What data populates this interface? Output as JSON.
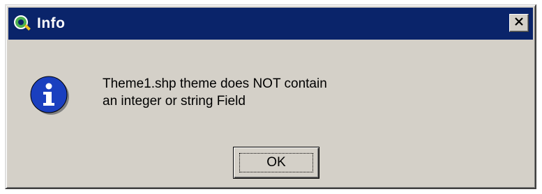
{
  "dialog": {
    "title": "Info",
    "app_icon": "qgis-icon",
    "close_icon": "close-icon",
    "message_icon": "info-icon",
    "message_lines": [
      "Theme1.shp theme does NOT contain",
      "an integer or string Field"
    ],
    "ok_label": "OK"
  },
  "colors": {
    "titlebar": "#0a246a",
    "dialog_bg": "#d4d0c8",
    "info_icon_fill": "#1a3fbf"
  }
}
